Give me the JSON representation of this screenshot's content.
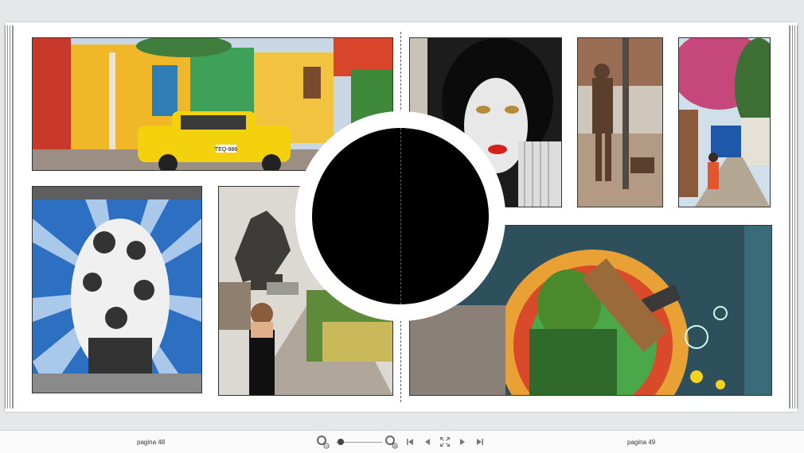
{
  "viewer": {
    "left_page_label": "pagina 48",
    "right_page_label": "pagina 49"
  },
  "icons": {
    "zoom_out": "zoom-out-icon",
    "zoom_in": "zoom-in-icon",
    "first": "first-page-icon",
    "prev": "previous-page-icon",
    "fit": "fit-page-icon",
    "next": "next-page-icon",
    "last": "last-page-icon"
  },
  "zoom_level_fraction": 0.1,
  "spread": {
    "photos": [
      {
        "name": "photo-colorful-street-taxi",
        "taxi_plate": "TEQ-886"
      },
      {
        "name": "photo-woman-mural"
      },
      {
        "name": "photo-bronze-statues"
      },
      {
        "name": "photo-bougainvillea-street"
      },
      {
        "name": "photo-blue-wall-mural"
      },
      {
        "name": "photo-pegasus-statue"
      },
      {
        "name": "photo-singer-mural"
      }
    ]
  },
  "colors": {
    "background": "#e6e7e8",
    "page": "#ffffff",
    "circle": "#000000"
  }
}
